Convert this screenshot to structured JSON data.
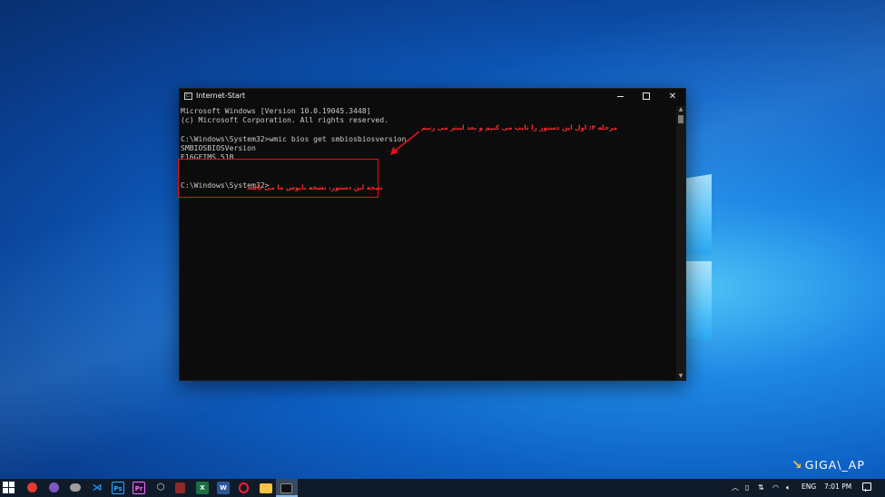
{
  "window": {
    "title": "Internet-Start",
    "minimize_icon": "minimize-icon",
    "maximize_icon": "maximize-icon",
    "close_icon": "close-icon"
  },
  "terminal": {
    "lines": [
      "Microsoft Windows [Version 10.0.19045.3448]",
      "(c) Microsoft Corporation. All rights reserved.",
      "",
      "C:\\Windows\\System32>wmic bios get smbiosbiosversion",
      "SMBIOSBIOSVersion",
      "E16GFIMS.51B",
      "",
      "",
      "C:\\Windows\\System32>"
    ]
  },
  "annotations": {
    "step_note": "مرحله ۴: اول این دستور را تایپ می کنیم و بعد اینتر می زنیم",
    "result_note": "نتیجه این دستور، نسخه بایوس ما می باشد",
    "color": "#e0121f"
  },
  "watermark": {
    "text": "GIGA\\_AP"
  },
  "taskbar": {
    "apps": [
      {
        "name": "chrome-icon",
        "color": "#e53935"
      },
      {
        "name": "tor-icon",
        "color": "#7e57c2"
      },
      {
        "name": "onedrive-icon",
        "color": "#9e9e9e"
      },
      {
        "name": "vscode-icon",
        "color": "#2196f3"
      },
      {
        "name": "photoshop-icon",
        "color": "#31a8ff"
      },
      {
        "name": "premiere-icon",
        "color": "#ea77ff"
      },
      {
        "name": "box-icon",
        "color": "#bdbdbd"
      },
      {
        "name": "archive-icon",
        "color": "#d32f2f"
      },
      {
        "name": "excel-icon",
        "color": "#1d6f42"
      },
      {
        "name": "word-icon",
        "color": "#2b579a"
      },
      {
        "name": "opera-icon",
        "color": "#ff1b2d"
      },
      {
        "name": "file-explorer-icon",
        "color": "#f6c344"
      },
      {
        "name": "terminal-icon",
        "color": "#111111"
      }
    ],
    "tray": {
      "language": "ENG",
      "time": "7:01 PM"
    }
  }
}
